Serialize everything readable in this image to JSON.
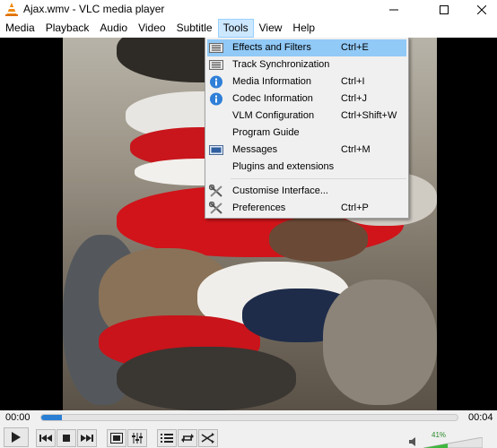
{
  "window": {
    "title": "Ajax.wmv - VLC media player"
  },
  "menubar": {
    "items": [
      {
        "label": "Media",
        "name": "menu-media"
      },
      {
        "label": "Playback",
        "name": "menu-playback"
      },
      {
        "label": "Audio",
        "name": "menu-audio"
      },
      {
        "label": "Video",
        "name": "menu-video"
      },
      {
        "label": "Subtitle",
        "name": "menu-subtitle"
      },
      {
        "label": "Tools",
        "name": "menu-tools",
        "active": true
      },
      {
        "label": "View",
        "name": "menu-view"
      },
      {
        "label": "Help",
        "name": "menu-help"
      }
    ]
  },
  "tools_menu": {
    "items": [
      {
        "label": "Effects and Filters",
        "shortcut": "Ctrl+E",
        "icon": "sliders-icon",
        "highlighted": true
      },
      {
        "label": "Track Synchronization",
        "shortcut": "",
        "icon": "sliders-icon"
      },
      {
        "label": "Media Information",
        "shortcut": "Ctrl+I",
        "icon": "info-icon"
      },
      {
        "label": "Codec Information",
        "shortcut": "Ctrl+J",
        "icon": "info-icon"
      },
      {
        "label": "VLM Configuration",
        "shortcut": "Ctrl+Shift+W",
        "icon": ""
      },
      {
        "label": "Program Guide",
        "shortcut": "",
        "icon": ""
      },
      {
        "label": "Messages",
        "shortcut": "Ctrl+M",
        "icon": "messages-icon"
      },
      {
        "label": "Plugins and extensions",
        "shortcut": "",
        "icon": ""
      },
      {
        "label": "Customise Interface...",
        "shortcut": "",
        "icon": "tools-icon"
      },
      {
        "label": "Preferences",
        "shortcut": "Ctrl+P",
        "icon": "tools-icon"
      }
    ]
  },
  "player": {
    "elapsed": "00:00",
    "duration": "00:04",
    "progress": 0.05,
    "volume_label": "41%",
    "volume": 0.41
  },
  "colors": {
    "accent": "#2a7fd4",
    "menu_highlight": "#91c9f7",
    "volume_green": "#2a8a2a"
  }
}
